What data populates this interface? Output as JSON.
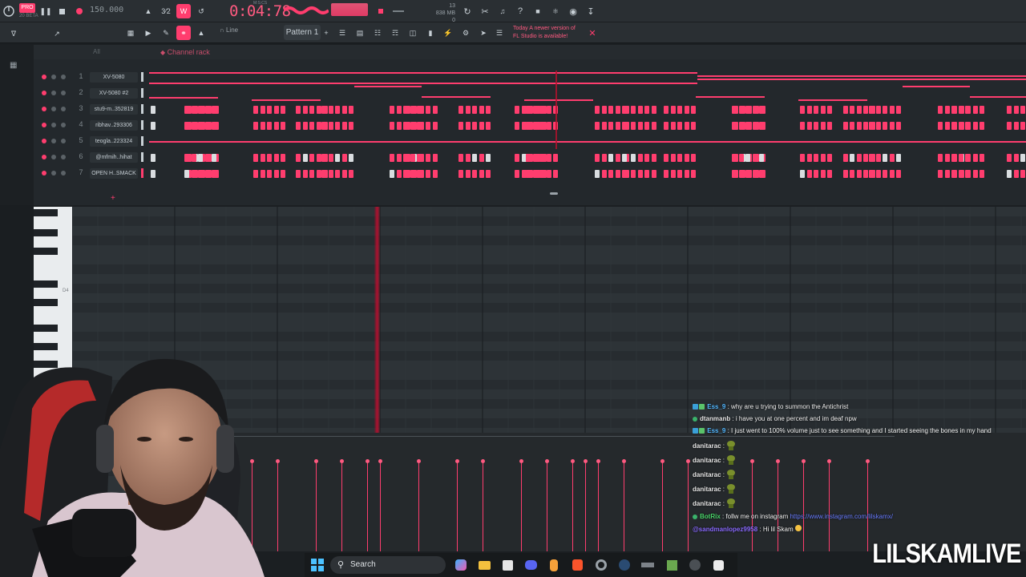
{
  "app": {
    "logo_badge": "PRO",
    "logo_sub": "20 BETA",
    "tempo": "150.000",
    "song_time": "0:04:78",
    "time_unit_label": "M:S:CS",
    "memory_line1": "13",
    "memory_line2": "838 MB",
    "memory_line3": "0",
    "pattern_label": "Pattern 1",
    "snap_label": "Line",
    "news_line1": "Today  A newer version of",
    "news_line2": "FL Studio is available!"
  },
  "channel_rack": {
    "title": "Channel rack",
    "filter_label": "All",
    "channels": [
      {
        "num": "1",
        "name": "XV-5080"
      },
      {
        "num": "2",
        "name": "XV-5080 #2"
      },
      {
        "num": "3",
        "name": "stu9-m..352819"
      },
      {
        "num": "4",
        "name": "ribhav..293306"
      },
      {
        "num": "5",
        "name": "teogla..223324"
      },
      {
        "num": "6",
        "name": "@mfmih..hihat"
      },
      {
        "num": "7",
        "name": "OPEN H..SMACK"
      }
    ]
  },
  "piano_roll": {
    "key_label": "D4"
  },
  "chat": {
    "messages": [
      {
        "user": "Ess_9",
        "text": " : why are u trying to summon the Antichrist"
      },
      {
        "user": "dtanmanb",
        "text": " : i have you at one percent and im deaf npw"
      },
      {
        "user": "Ess_9",
        "text": " : I just went to 100% volume just to see something and I started seeing the bones in my hand"
      },
      {
        "user": "danitarac",
        "text": " :"
      },
      {
        "user": "danitarac",
        "text": " :"
      },
      {
        "user": "danitarac",
        "text": " :"
      },
      {
        "user": "danitarac",
        "text": " :"
      },
      {
        "user": "danitarac",
        "text": " :"
      },
      {
        "user": "BotRix",
        "text": " : follw me on instagram ",
        "link": "https://www.instagram.com/lilskamx/"
      },
      {
        "user": "@sandmanlopez9958",
        "text": " : Hi lil Skam"
      }
    ]
  },
  "taskbar": {
    "search_label": "Search"
  },
  "watermark": "LILSKAMLIVE",
  "colors": {
    "accent": "#ff3d6e",
    "playhead": "#b01030",
    "bg": "#1b1f22",
    "panel": "#2a2f33"
  }
}
